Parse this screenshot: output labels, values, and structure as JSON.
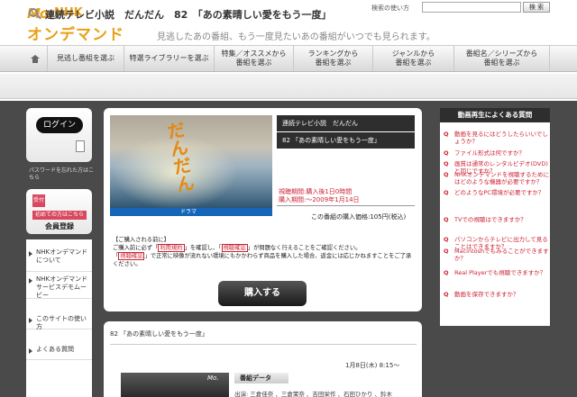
{
  "header": {
    "logo_prefix": "Mo.",
    "logo_brand": "NHK",
    "logo_main": "オンデマンド",
    "tagline": "見逃したあの番組、もう一度見たいあの番組がいつでも見られます。",
    "help_link": "検索の使い方",
    "search_placeholder": "",
    "search_button": "検 索"
  },
  "nav": {
    "items": [
      {
        "label": "見逃し番組を選ぶ"
      },
      {
        "label": "特選ライブラリーを選ぶ"
      },
      {
        "label": "特集／オススメから\n番組を選ぶ"
      },
      {
        "label": "ランキングから\n番組を選ぶ"
      },
      {
        "label": "ジャンルから\n番組を選ぶ"
      },
      {
        "label": "番組名／シリーズから\n番組を選ぶ"
      }
    ]
  },
  "page_title": "連続テレビ小説　だんだん　82　「あの素晴しい愛をもう一度」",
  "sidebar": {
    "login": "ログイン",
    "password_help": "パスワードを忘れた方はこちら",
    "register_tag": "受付",
    "register_new": "初めての方はこちら",
    "register_label": "会員登録",
    "items": [
      {
        "label": "NHKオンデマンドについて"
      },
      {
        "label": "NHKオンデマンドサービスデモムービー"
      },
      {
        "label": "このサイトの使い方"
      },
      {
        "label": "よくある質問"
      }
    ]
  },
  "program": {
    "thumb_glyph": "だんだん",
    "drama_label": "ドラマ",
    "series_title": "連続テレビ小説　だんだん",
    "episode": "82 「あの素晴しい愛をもう一度」",
    "period_watch": "視聴期間:購入後1日0時間",
    "period_purchase": "購入期間:～2009年1月14日",
    "price": "この番組の購入価格:105円(税込)"
  },
  "notice": {
    "heading": "【ご購入される前に】",
    "line1_a": "ご購入前に必ず「",
    "link_terms": "利用規約",
    "line1_b": "」を確認し、「",
    "link_env": "視聴確認",
    "line1_c": "」が問題なく行えることをご確認ください。",
    "line2_a": "「",
    "link_env2": "視聴確認",
    "line2_b": "」で正常に映像が流れない環境にもかかわらず商品を購入した場合、返金には応じかねますことをご了承ください。"
  },
  "buy_button": "購入する",
  "episode_panel": {
    "title": "82 「あの素晴しい愛をもう一度」",
    "date": "1月8日(木) 8:15～",
    "data_tab": "番組データ",
    "cast": "出演: 三倉佳奈 、三倉茉奈 、吉田栄作 、石田ひかり 、鈴木"
  },
  "faq": {
    "header": "動画再生によくある質問",
    "items": [
      "動画を見るにはどうしたらいいでしょうか？",
      "ファイル形式は何ですか？",
      "画質は通常のレンタルビデオ(DVD)と同じですか？",
      "NHKオンデマンドを視聴するためにはどのような機器が必要ですか？",
      "どのようなPC環境が必要ですか？",
      "TVでの視聴はできますか？",
      "パソコンからテレビに出力して見ることはできますか？",
      "Macintoshでもみることができますか？",
      "Real Playerでも視聴できますか？",
      "動画を保存できますか？"
    ]
  }
}
